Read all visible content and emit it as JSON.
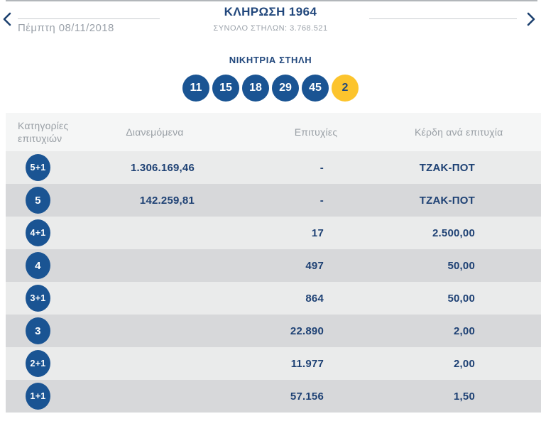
{
  "header": {
    "draw_title": "ΚΛΗΡΩΣΗ 1964",
    "total_columns": "ΣΥΝΟΛΟ ΣΤΗΛΩΝ: 3.768.521",
    "date": "Πέμπτη 08/11/2018",
    "prev_icon": "chevron-left",
    "next_icon": "chevron-right"
  },
  "winning": {
    "title": "ΝΙΚΗΤΡΙΑ ΣΤΗΛΗ",
    "numbers": [
      "11",
      "15",
      "18",
      "29",
      "45"
    ],
    "bonus": "2"
  },
  "table": {
    "col_categories": "Κατηγορίες επιτυχιών",
    "col_distributed": "Διανεμόμενα",
    "col_wins": "Επιτυχίες",
    "col_winnings": "Κέρδη ανά επιτυχία",
    "rows": [
      {
        "tier": "5+1",
        "distributed": "1.306.169,46",
        "wins": "-",
        "winnings": "ΤΖΑΚ-ΠΟΤ"
      },
      {
        "tier": "5",
        "distributed": "142.259,81",
        "wins": "-",
        "winnings": "ΤΖΑΚ-ΠΟΤ"
      },
      {
        "tier": "4+1",
        "distributed": "",
        "wins": "17",
        "winnings": "2.500,00"
      },
      {
        "tier": "4",
        "distributed": "",
        "wins": "497",
        "winnings": "50,00"
      },
      {
        "tier": "3+1",
        "distributed": "",
        "wins": "864",
        "winnings": "50,00"
      },
      {
        "tier": "3",
        "distributed": "",
        "wins": "22.890",
        "winnings": "2,00"
      },
      {
        "tier": "2+1",
        "distributed": "",
        "wins": "11.977",
        "winnings": "2,00"
      },
      {
        "tier": "1+1",
        "distributed": "",
        "wins": "57.156",
        "winnings": "1,50"
      }
    ]
  },
  "colors": {
    "ball_blue": "#1a5493",
    "bonus_yellow": "#fcc42d",
    "navy_text": "#21477c",
    "gray_text": "#9ba2aa",
    "row_light": "#eaebeb",
    "row_dark": "#d7d8da",
    "header_bg": "#f5f6f6"
  }
}
